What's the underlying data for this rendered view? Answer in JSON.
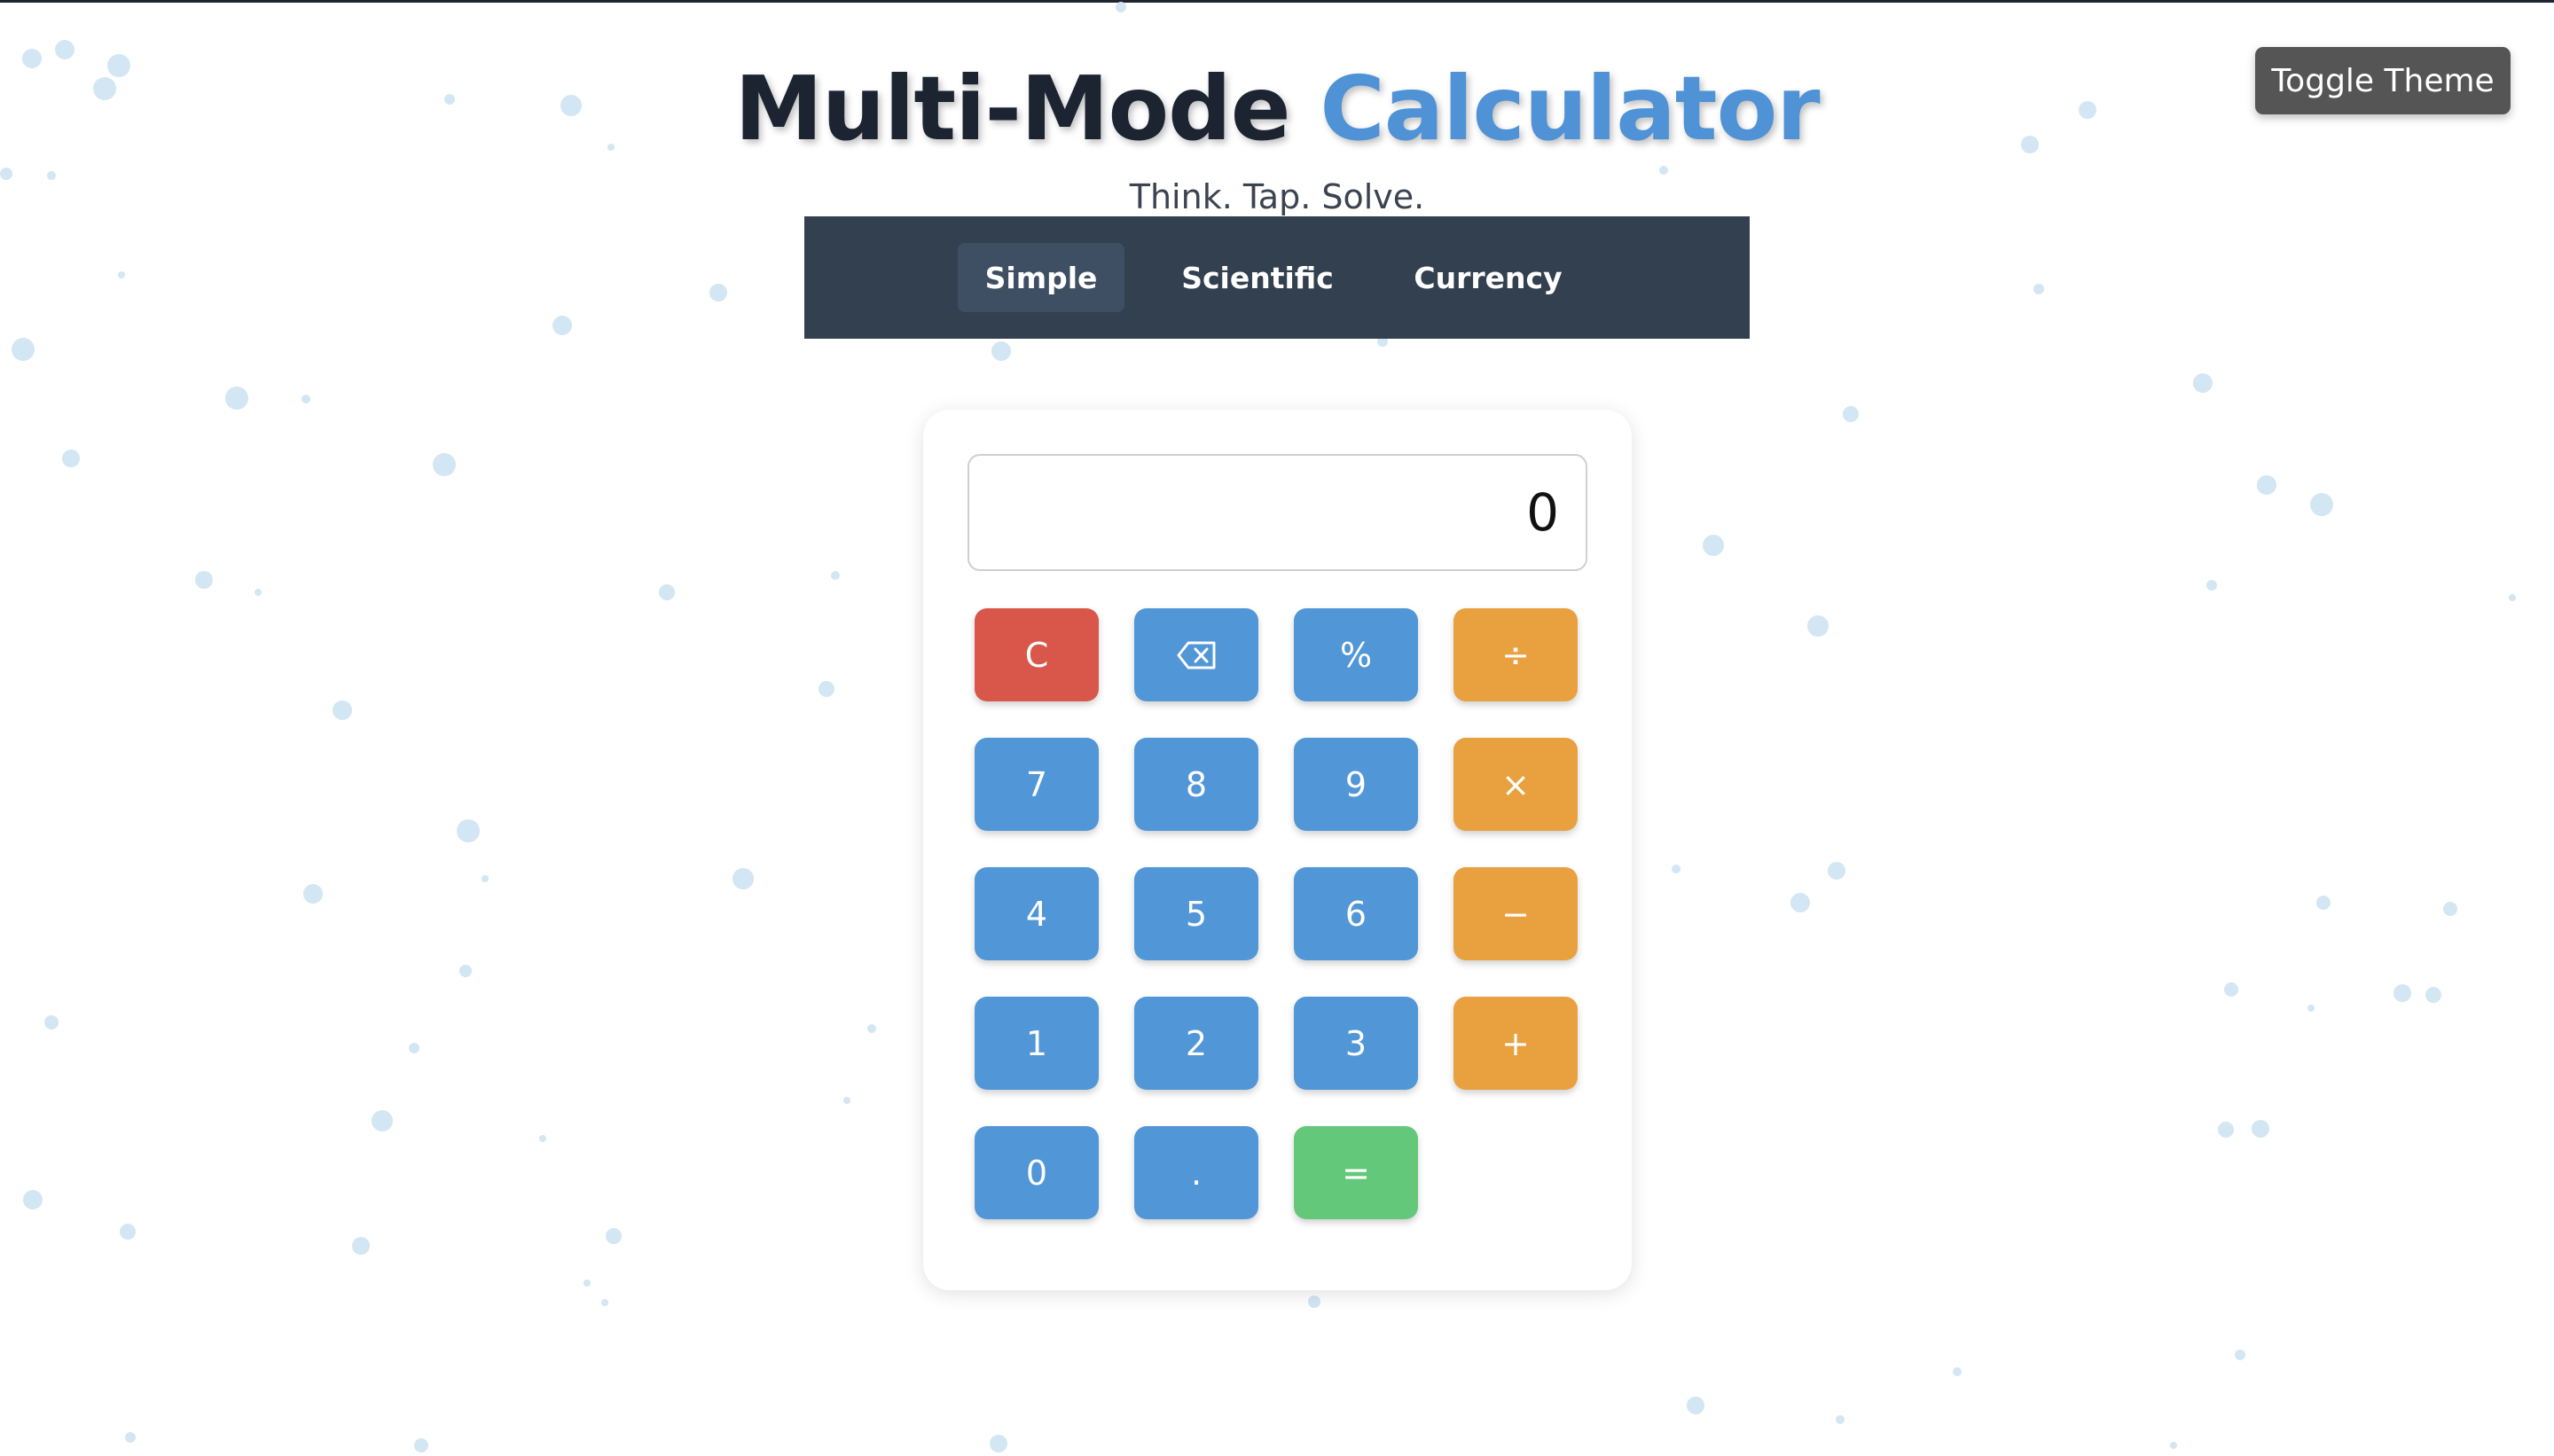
{
  "header": {
    "title_part1": "Multi-Mode",
    "title_part2": "Calculator",
    "subtitle": "Think. Tap. Solve."
  },
  "theme_toggle": {
    "label": "Toggle Theme"
  },
  "nav": {
    "tabs": [
      {
        "label": "Simple",
        "active": true
      },
      {
        "label": "Scientific",
        "active": false
      },
      {
        "label": "Currency",
        "active": false
      }
    ]
  },
  "calculator": {
    "display_value": "0",
    "keys": {
      "clear": "C",
      "backspace": "⌫",
      "percent": "%",
      "divide": "÷",
      "seven": "7",
      "eight": "8",
      "nine": "9",
      "multiply": "×",
      "four": "4",
      "five": "5",
      "six": "6",
      "subtract": "−",
      "one": "1",
      "two": "2",
      "three": "3",
      "add": "+",
      "zero": "0",
      "decimal": ".",
      "equals": "="
    }
  },
  "colors": {
    "accent_blue": "#5196d7",
    "clear_red": "#d9574a",
    "operator_orange": "#e9a03f",
    "equals_green": "#64c87a",
    "navbar_bg": "#33404f",
    "title_dark": "#1c2431",
    "title_blue": "#4f92d6",
    "bubble": "#d3e6f3"
  }
}
